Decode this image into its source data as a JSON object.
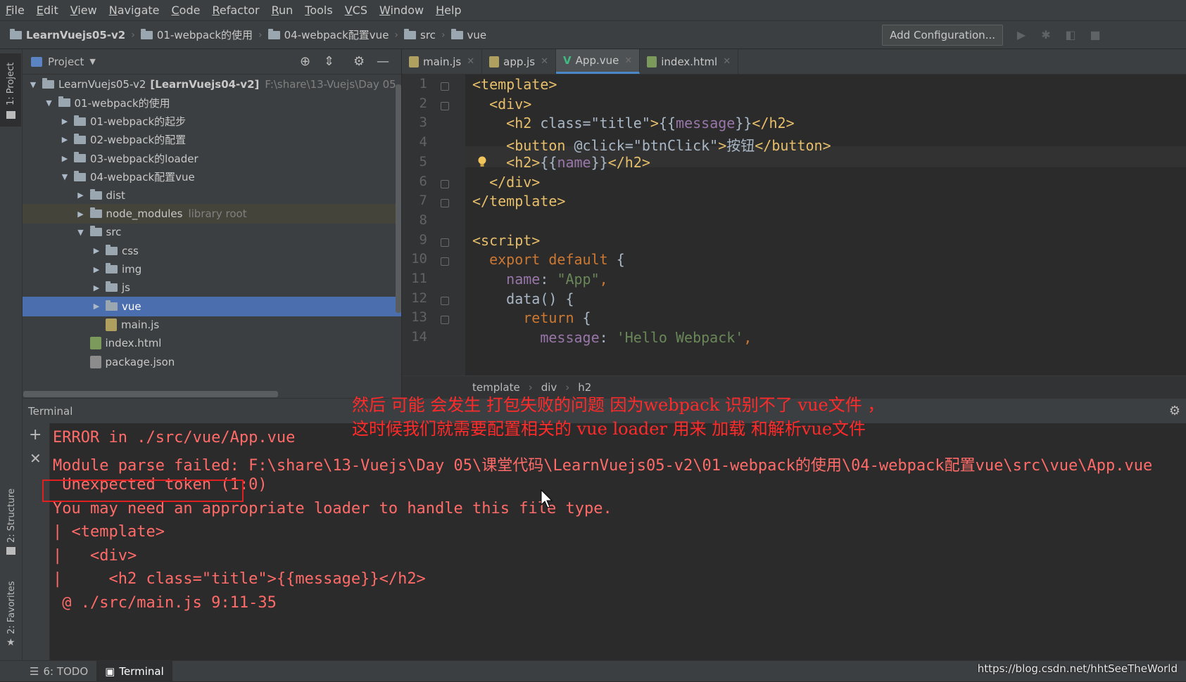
{
  "menu": [
    "File",
    "Edit",
    "View",
    "Navigate",
    "Code",
    "Refactor",
    "Run",
    "Tools",
    "VCS",
    "Window",
    "Help"
  ],
  "breadcrumbs": [
    "LearnVuejs05-v2",
    "01-webpack的使用",
    "04-webpack配置vue",
    "src",
    "vue"
  ],
  "toolbar": {
    "add_configuration": "Add Configuration..."
  },
  "left_stripe": {
    "project": "1: Project",
    "structure": "2: Structure",
    "favorites": "2: Favorites"
  },
  "project_panel": {
    "title": "Project",
    "tree": [
      {
        "label": "LearnVuejs05-v2",
        "bold": "[LearnVuejs04-v2]",
        "extra": "F:\\share\\13-Vuejs\\Day 05",
        "level": 0,
        "expanded": true,
        "type": "folder"
      },
      {
        "label": "01-webpack的使用",
        "level": 1,
        "expanded": true,
        "type": "folder"
      },
      {
        "label": "01-webpack的起步",
        "level": 2,
        "expanded": false,
        "type": "folder"
      },
      {
        "label": "02-webpack的配置",
        "level": 2,
        "expanded": false,
        "type": "folder"
      },
      {
        "label": "03-webpack的loader",
        "level": 2,
        "expanded": false,
        "type": "folder"
      },
      {
        "label": "04-webpack配置vue",
        "level": 2,
        "expanded": true,
        "type": "folder"
      },
      {
        "label": "dist",
        "level": 3,
        "expanded": false,
        "type": "folder"
      },
      {
        "label": "node_modules",
        "extra": "library root",
        "level": 3,
        "expanded": false,
        "type": "folder",
        "lib": true
      },
      {
        "label": "src",
        "level": 3,
        "expanded": true,
        "type": "folder"
      },
      {
        "label": "css",
        "level": 4,
        "expanded": false,
        "type": "folder"
      },
      {
        "label": "img",
        "level": 4,
        "expanded": false,
        "type": "folder"
      },
      {
        "label": "js",
        "level": 4,
        "expanded": false,
        "type": "folder"
      },
      {
        "label": "vue",
        "level": 4,
        "expanded": false,
        "type": "folder",
        "selected": true
      },
      {
        "label": "main.js",
        "level": 4,
        "type": "js"
      },
      {
        "label": "index.html",
        "level": 3,
        "type": "html"
      },
      {
        "label": "package.json",
        "level": 3,
        "type": "json"
      }
    ]
  },
  "editor_tabs": [
    {
      "label": "main.js",
      "type": "js"
    },
    {
      "label": "app.js",
      "type": "js"
    },
    {
      "label": "App.vue",
      "type": "vue",
      "active": true
    },
    {
      "label": "index.html",
      "type": "html"
    }
  ],
  "code_lines": [
    [
      [
        "tag",
        "<template>"
      ]
    ],
    [
      [
        "plain",
        "  "
      ],
      [
        "tag",
        "<div>"
      ]
    ],
    [
      [
        "plain",
        "    "
      ],
      [
        "tag",
        "<h2 "
      ],
      [
        "plain",
        "class="
      ],
      [
        "plain",
        "\"title\""
      ],
      [
        "tag",
        ">"
      ],
      [
        "plain",
        "{{"
      ],
      [
        "ivar",
        "message"
      ],
      [
        "plain",
        "}}"
      ],
      [
        "tag",
        "</h2>"
      ]
    ],
    [
      [
        "plain",
        "    "
      ],
      [
        "tag",
        "<button "
      ],
      [
        "plain",
        "@click="
      ],
      [
        "plain",
        "\"btnClick\""
      ],
      [
        "tag",
        ">"
      ],
      [
        "plain",
        "按钮"
      ],
      [
        "tag",
        "</button>"
      ]
    ],
    [
      [
        "plain",
        "    "
      ],
      [
        "tag",
        "<h2>"
      ],
      [
        "plain",
        "{{"
      ],
      [
        "ivar",
        "name"
      ],
      [
        "plain",
        "}}"
      ],
      [
        "tag",
        "</h2>"
      ]
    ],
    [
      [
        "plain",
        "  "
      ],
      [
        "tag",
        "</div>"
      ]
    ],
    [
      [
        "tag",
        "</template>"
      ]
    ],
    [
      [
        "plain",
        ""
      ]
    ],
    [
      [
        "tag",
        "<script>"
      ]
    ],
    [
      [
        "plain",
        "  "
      ],
      [
        "kw",
        "export default "
      ],
      [
        "plain",
        "{"
      ]
    ],
    [
      [
        "plain",
        "    "
      ],
      [
        "ivar",
        "name"
      ],
      [
        "plain",
        ": "
      ],
      [
        "str",
        "\"App\""
      ],
      [
        "kw",
        ","
      ]
    ],
    [
      [
        "plain",
        "    data() {"
      ]
    ],
    [
      [
        "plain",
        "      "
      ],
      [
        "kw",
        "return "
      ],
      [
        "plain",
        "{"
      ]
    ],
    [
      [
        "plain",
        "        "
      ],
      [
        "ivar",
        "message"
      ],
      [
        "plain",
        ": "
      ],
      [
        "str",
        "'Hello Webpack'"
      ],
      [
        "kw",
        ","
      ]
    ]
  ],
  "line_numbers": [
    "1",
    "2",
    "3",
    "4",
    "5",
    "6",
    "7",
    "8",
    "9",
    "10",
    "11",
    "12",
    "13",
    "14"
  ],
  "editor_breadcrumbs": [
    "template",
    "div",
    "h2"
  ],
  "terminal": {
    "title": "Terminal",
    "lines": [
      "ERROR in ./src/vue/App.vue",
      "Module parse failed: F:\\share\\13-Vuejs\\Day 05\\课堂代码\\LearnVuejs05-v2\\01-webpack的使用\\04-webpack配置vue\\src\\vue\\App.vue",
      " Unexpected token (1:0)",
      "You may need an appropriate loader to handle this file type.",
      "| <template>",
      "|   <div>",
      "|     <h2 class=\"title\">{{message}}</h2>",
      " @ ./src/main.js 9:11-35"
    ],
    "annotation_1": "然后 可能 会发生  打包失败的问题  因为webpack 识别不了 vue文件 ，",
    "annotation_2": "这时候我们就需要配置相关的   vue  loader  用来 加载  和解析vue文件"
  },
  "status_bar": {
    "todo": "6: TODO",
    "terminal": "Terminal"
  },
  "watermark": "https://blog.csdn.net/hhtSeeTheWorld"
}
